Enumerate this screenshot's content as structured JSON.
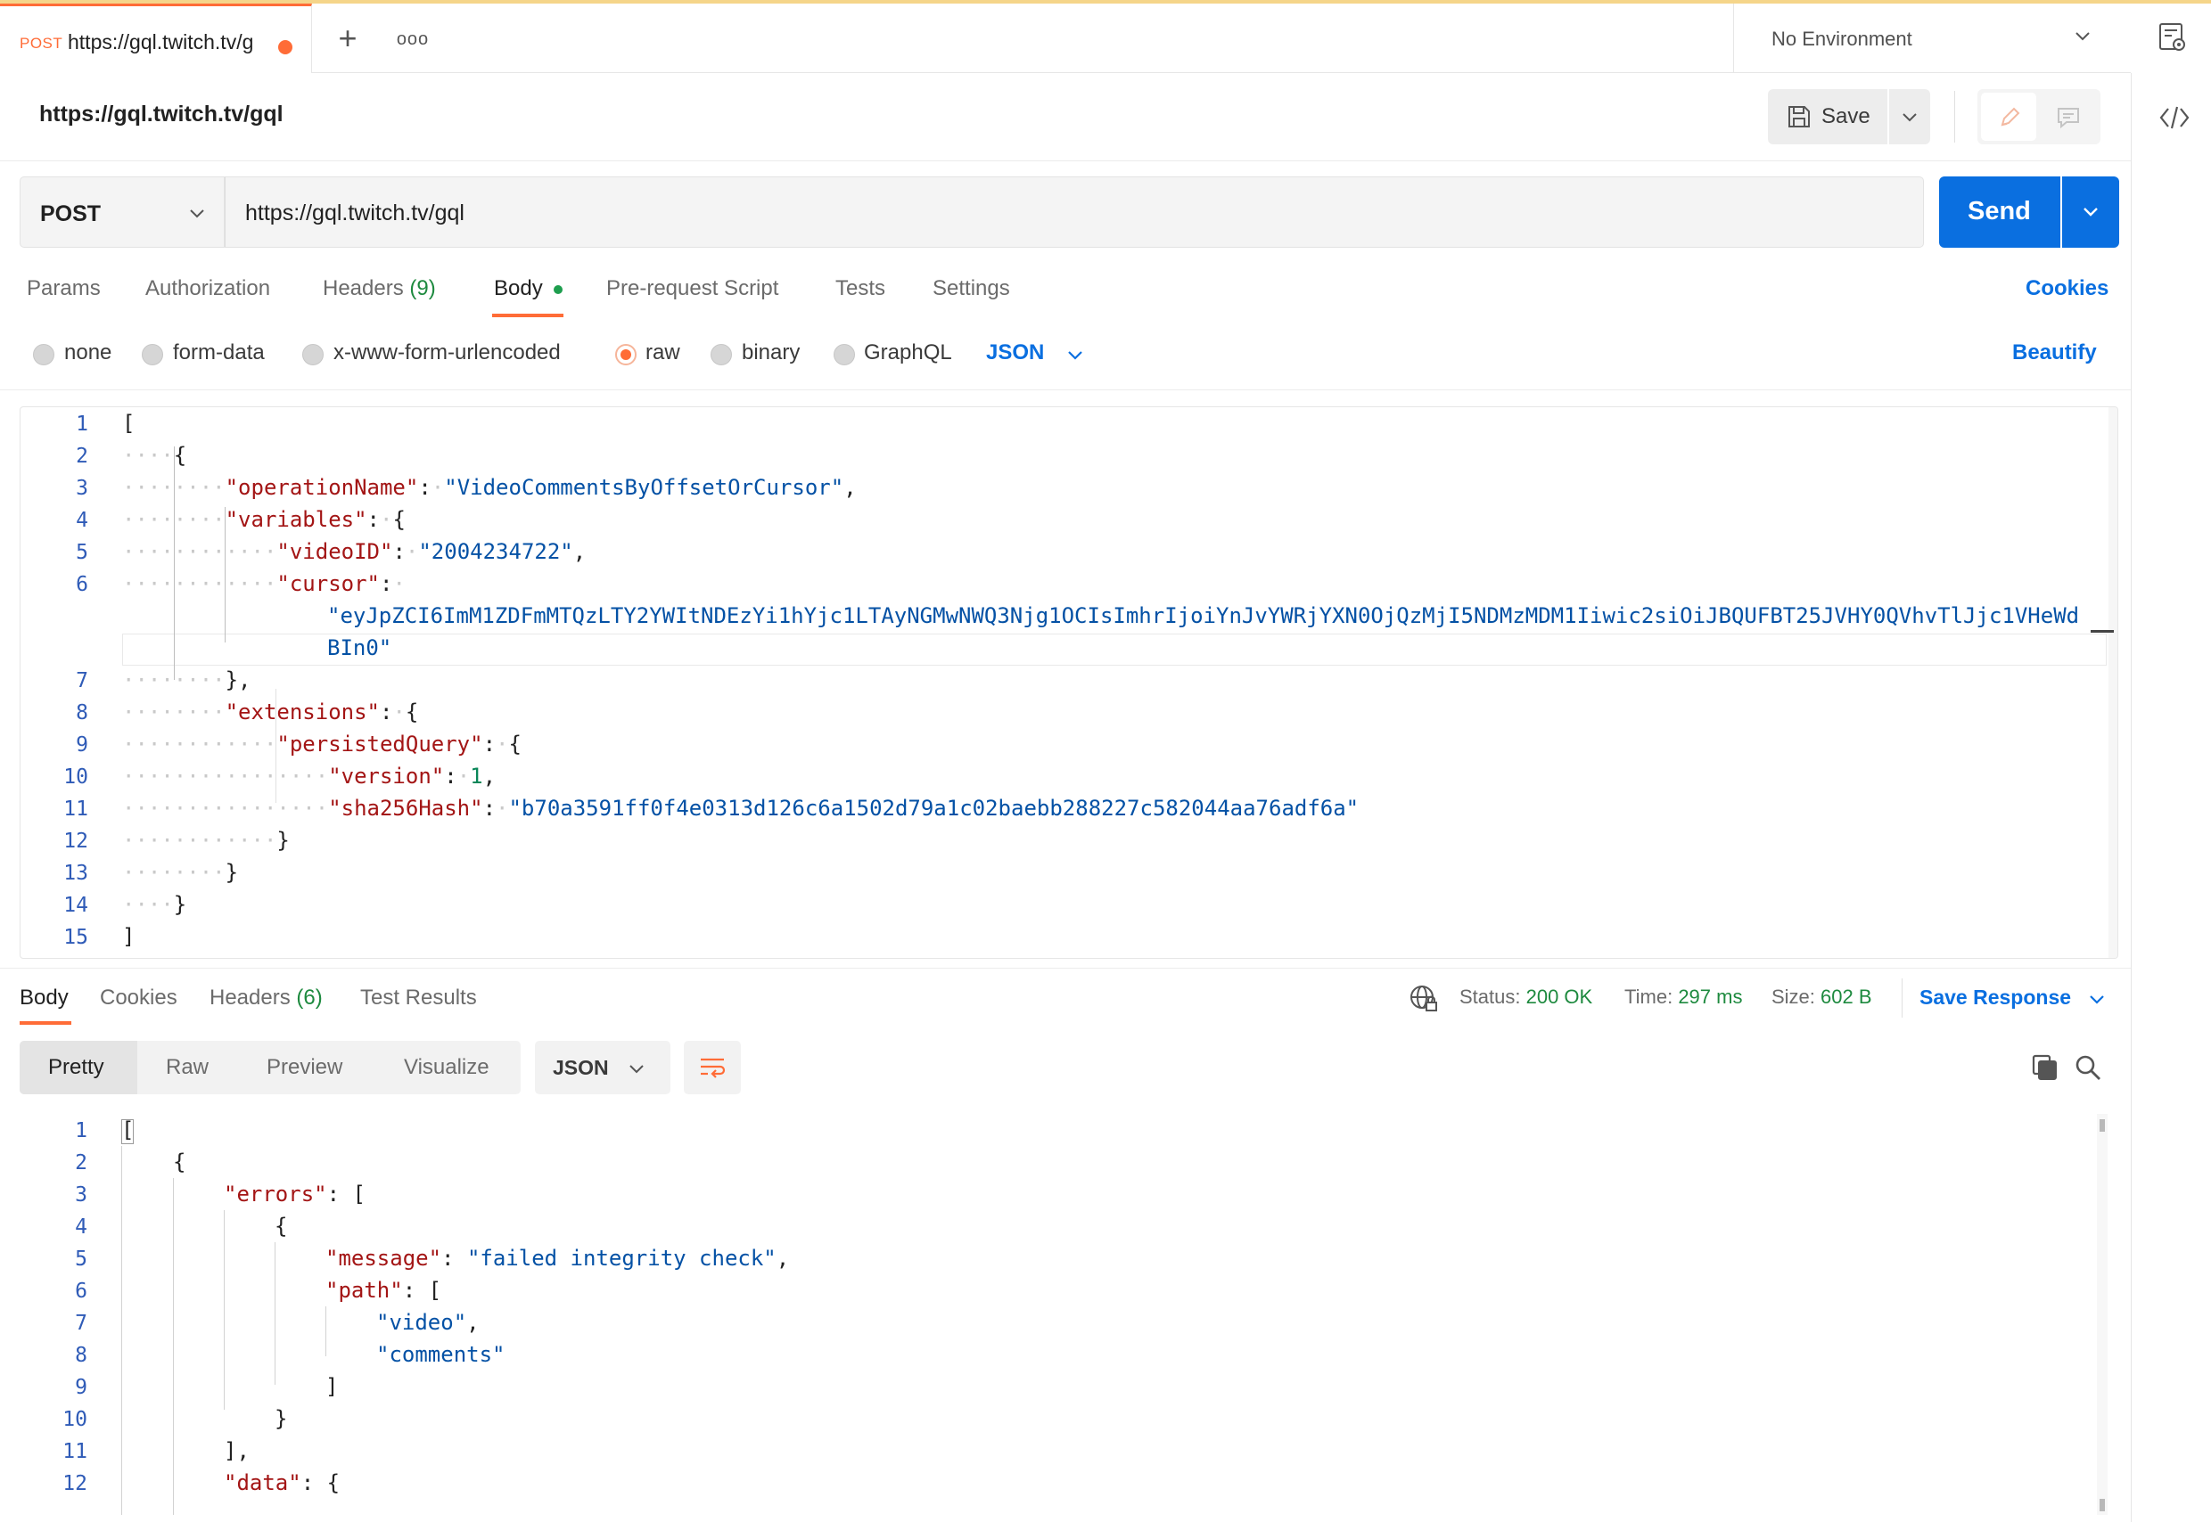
{
  "tab": {
    "method": "POST",
    "title": "https://gql.twitch.tv/g",
    "new_tab": "+",
    "more": "ooo"
  },
  "environment": {
    "selected": "No Environment"
  },
  "request": {
    "name": "https://gql.twitch.tv/gql",
    "save_label": "Save",
    "method": "POST",
    "url": "https://gql.twitch.tv/gql",
    "send_label": "Send"
  },
  "request_tabs": {
    "params": "Params",
    "authorization": "Authorization",
    "headers": "Headers",
    "headers_count": "(9)",
    "body": "Body",
    "prerequest": "Pre-request Script",
    "tests": "Tests",
    "settings": "Settings",
    "cookies": "Cookies"
  },
  "body_types": {
    "none": "none",
    "form_data": "form-data",
    "urlencoded": "x-www-form-urlencoded",
    "raw": "raw",
    "binary": "binary",
    "graphql": "GraphQL",
    "format": "JSON",
    "beautify": "Beautify",
    "selected": "raw"
  },
  "request_body": {
    "line_numbers": [
      "1",
      "2",
      "3",
      "4",
      "5",
      "6",
      "",
      "7",
      "8",
      "9",
      "10",
      "11",
      "12",
      "13",
      "14",
      "15"
    ],
    "operation_key": "\"operationName\"",
    "operation_value": "\"VideoCommentsByOffsetOrCursor\"",
    "variables_key": "\"variables\"",
    "video_id_key": "\"videoID\"",
    "video_id_value": "\"2004234722\"",
    "cursor_key": "\"cursor\"",
    "cursor_value_line1": "\"eyJpZCI6ImM1ZDFmMTQzLTY2YWItNDEzYi1hYjc1LTAyNGMwNWQ3Njg1OCIsImhrIjoiYnJvYWRjYXN0OjQzMjI5NDMzMDM1Iiwic2siOiJBQUFBT25JVHY0QVhvTlJjc1VHeWd",
    "cursor_value_line2": "BIn0\"",
    "extensions_key": "\"extensions\"",
    "persisted_key": "\"persistedQuery\"",
    "version_key": "\"version\"",
    "version_value": "1",
    "hash_key": "\"sha256Hash\"",
    "hash_value": "\"b70a3591ff0f4e0313d126c6a1502d79a1c02baebb288227c582044aa76adf6a\""
  },
  "response_tabs": {
    "body": "Body",
    "cookies": "Cookies",
    "headers": "Headers",
    "headers_count": "(6)",
    "test_results": "Test Results"
  },
  "response_meta": {
    "status_label": "Status:",
    "status_value": "200 OK",
    "time_label": "Time:",
    "time_value": "297 ms",
    "size_label": "Size:",
    "size_value": "602 B",
    "save_response": "Save Response"
  },
  "response_view": {
    "pretty": "Pretty",
    "raw": "Raw",
    "preview": "Preview",
    "visualize": "Visualize",
    "format": "JSON"
  },
  "response_body": {
    "line_numbers": [
      "1",
      "2",
      "3",
      "4",
      "5",
      "6",
      "7",
      "8",
      "9",
      "10",
      "11",
      "12"
    ],
    "errors_key": "\"errors\"",
    "message_key": "\"message\"",
    "message_value": "\"failed integrity check\"",
    "path_key": "\"path\"",
    "path_item1": "\"video\"",
    "path_item2": "\"comments\"",
    "data_key": "\"data\""
  },
  "colors": {
    "accent_orange": "#ff6c37",
    "primary_blue": "#0a6fe0",
    "status_green": "#1e8a3f",
    "json_key": "#a31515",
    "json_string": "#0451a5",
    "json_number": "#098658"
  }
}
